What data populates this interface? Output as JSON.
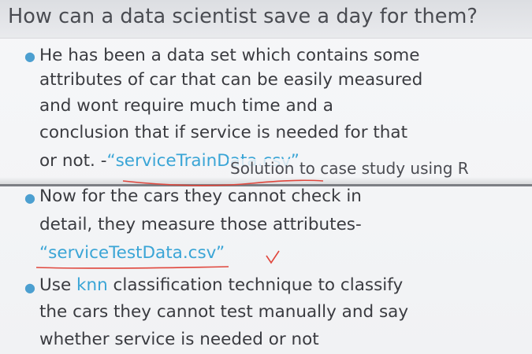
{
  "slide": {
    "title": "How can a data scientist save a day for them?",
    "bullets": [
      {
        "lines": [
          "He has been a data set which contains some",
          "attributes of car that can be easily measured",
          "and wont require much time and a",
          "conclusion that if service is needed for that"
        ],
        "last_line_prefix": "or not.  -",
        "file": "“serviceTrainData.csv”"
      },
      {
        "lines": [
          "Now for the cars they cannot check in",
          "detail, they measure those attributes-"
        ],
        "file": "“serviceTestData.csv”"
      },
      {
        "prefix": "Use ",
        "highlight": "knn",
        "lines_after": [
          " classification technique to classify",
          "the cars they cannot test manually and say",
          "whether service is needed or not"
        ]
      }
    ]
  },
  "caption": "Solution to case study using R",
  "colors": {
    "accent": "#3aa5d6",
    "text": "#3a3b40",
    "annotation_ink": "#e0463c"
  },
  "icons": [
    "bullet-dot-icon",
    "pen-underline-annotation",
    "pen-checkmark-annotation"
  ]
}
